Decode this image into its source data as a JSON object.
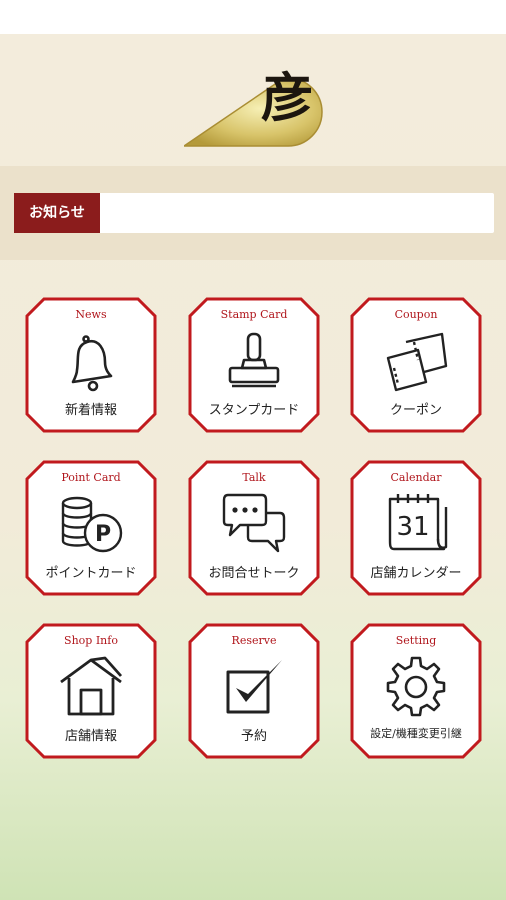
{
  "brand": {
    "logo_glyph": "彦"
  },
  "news": {
    "label": "お知らせ",
    "content": ""
  },
  "colors": {
    "accent": "#b0161c",
    "news_label_bg": "#8b1c1c"
  },
  "menu": [
    {
      "en": "News",
      "jp": "新着情報",
      "icon": "bell-icon"
    },
    {
      "en": "Stamp Card",
      "jp": "スタンプカード",
      "icon": "stamp-icon"
    },
    {
      "en": "Coupon",
      "jp": "クーポン",
      "icon": "coupon-icon"
    },
    {
      "en": "Point Card",
      "jp": "ポイントカード",
      "icon": "coins-icon"
    },
    {
      "en": "Talk",
      "jp": "お問合せトーク",
      "icon": "chat-bubbles-icon"
    },
    {
      "en": "Calendar",
      "jp": "店舗カレンダー",
      "icon": "calendar-icon",
      "day": "31"
    },
    {
      "en": "Shop Info",
      "jp": "店舗情報",
      "icon": "house-icon"
    },
    {
      "en": "Reserve",
      "jp": "予約",
      "icon": "checkbox-icon"
    },
    {
      "en": "Setting",
      "jp": "設定/機種変更引継",
      "icon": "gear-icon"
    }
  ]
}
